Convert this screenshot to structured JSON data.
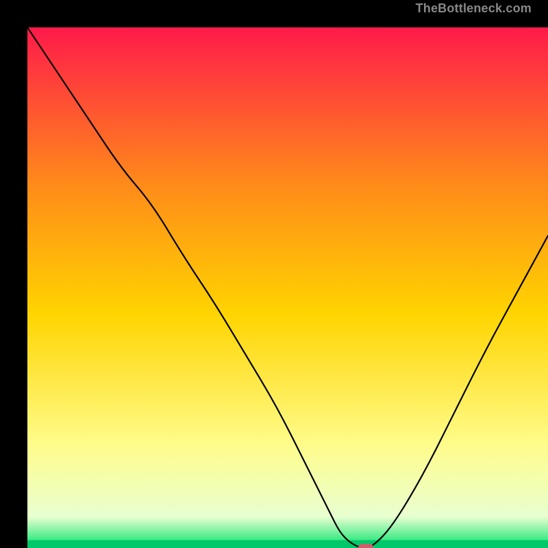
{
  "watermark": "TheBottleneck.com",
  "chart_data": {
    "type": "line",
    "title": "",
    "xlabel": "",
    "ylabel": "",
    "xlim": [
      0,
      100
    ],
    "ylim": [
      0,
      100
    ],
    "grid": false,
    "gradient_colors": {
      "top": "#ff1a4a",
      "upper_mid": "#ff8a1a",
      "mid": "#ffd400",
      "lower_mid": "#fffc8a",
      "near_bottom": "#e8ffd0",
      "bottom": "#00e36a"
    },
    "series": [
      {
        "name": "bottleneck-curve",
        "x": [
          0,
          6,
          12,
          18,
          24,
          30,
          36,
          42,
          48,
          54,
          58,
          60,
          62,
          64,
          66,
          70,
          76,
          82,
          88,
          94,
          100
        ],
        "y": [
          100,
          91,
          82,
          73,
          66,
          56,
          47,
          37,
          27,
          15,
          7,
          3,
          1,
          0,
          0,
          4,
          14,
          26,
          38,
          49,
          60
        ]
      }
    ],
    "marker": {
      "name": "optimal-point",
      "x": 65,
      "y": 0,
      "color": "#cf5e6c",
      "shape": "capsule"
    },
    "green_band_y": 1.5
  }
}
